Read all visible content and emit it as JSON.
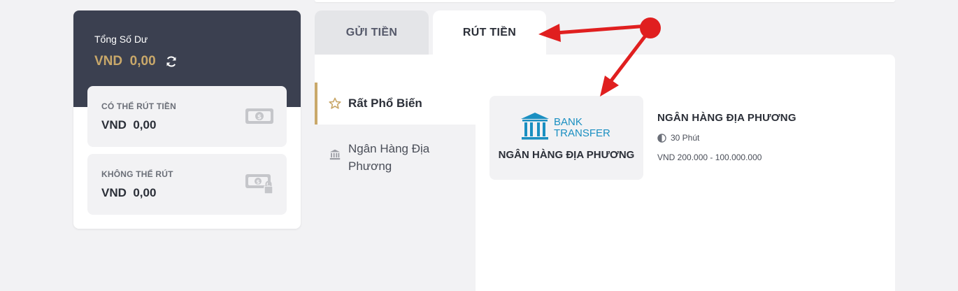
{
  "balance": {
    "label": "Tổng Số Dư",
    "amount": "VND  0,00",
    "refresh_icon": "refresh-icon",
    "withdrawable": {
      "title": "CÓ THỂ RÚT TIỀN",
      "value": "VND  0,00",
      "icon": "cash-icon"
    },
    "non_withdrawable": {
      "title": "KHÔNG THỂ RÚT",
      "value": "VND  0,00",
      "icon": "cash-lock-icon"
    }
  },
  "tabs": [
    {
      "label": "GỬI TIỀN",
      "active": false
    },
    {
      "label": "RÚT TIỀN",
      "active": true
    }
  ],
  "menu": [
    {
      "label": "Rất Phổ Biến",
      "icon": "star-icon",
      "active": true
    },
    {
      "label": "Ngân Hàng Địa Phương",
      "icon": "bank-icon",
      "active": false
    }
  ],
  "method": {
    "logo_line1": "BANK",
    "logo_line2": "TRANSFER",
    "card_name": "NGÂN HÀNG ĐỊA PHƯƠNG",
    "info_title": "NGÂN HÀNG ĐỊA PHƯƠNG",
    "time": "30 Phút",
    "limit": "VND 200.000 - 100.000.000"
  },
  "colors": {
    "accent_gold": "#c9a86a",
    "dark_header": "#3b4050",
    "bank_blue": "#1a8fc1",
    "annotation_red": "#e01f1f"
  }
}
